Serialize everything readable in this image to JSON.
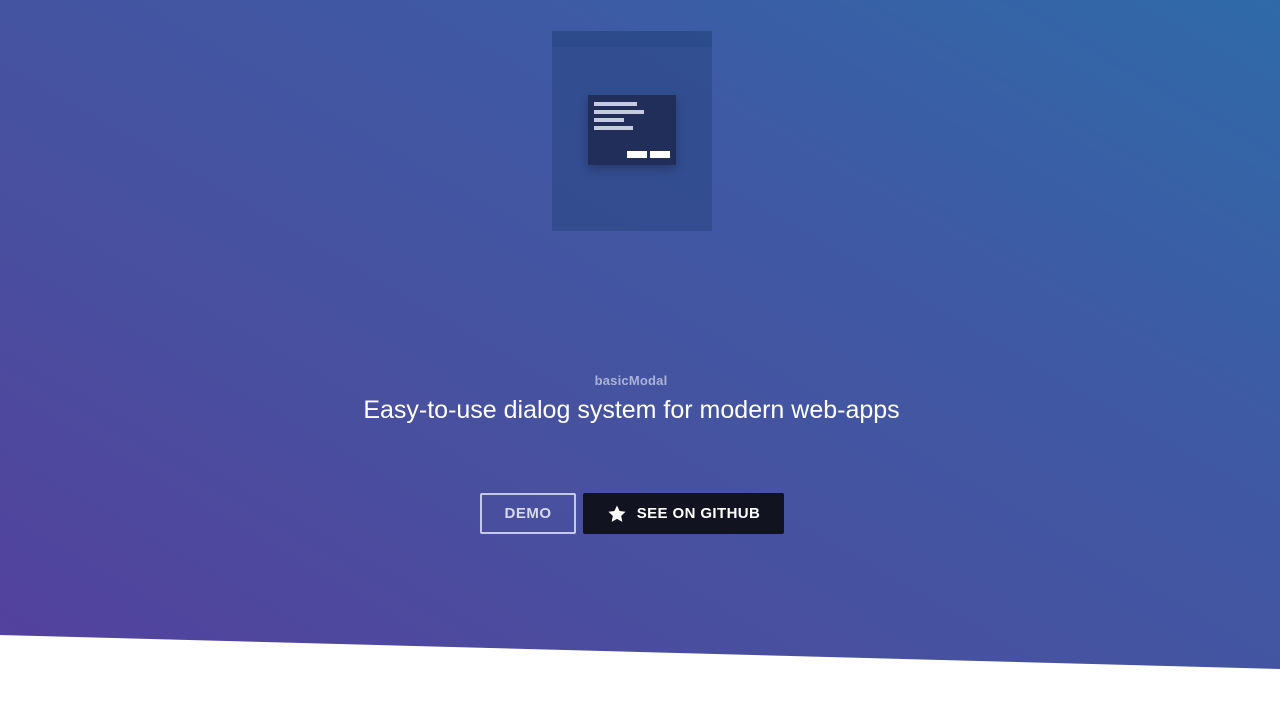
{
  "hero": {
    "app_name": "basicModal",
    "tagline": "Easy-to-use dialog system for modern web-apps"
  },
  "buttons": {
    "demo_label": "DEMO",
    "github_label": "SEE ON GITHUB",
    "github_icon": "star-icon"
  },
  "colors": {
    "gradient_start": "#553f9e",
    "gradient_end": "#2f6aa8",
    "github_button_bg": "#121321",
    "demo_button_border": "#c5c9e8"
  }
}
